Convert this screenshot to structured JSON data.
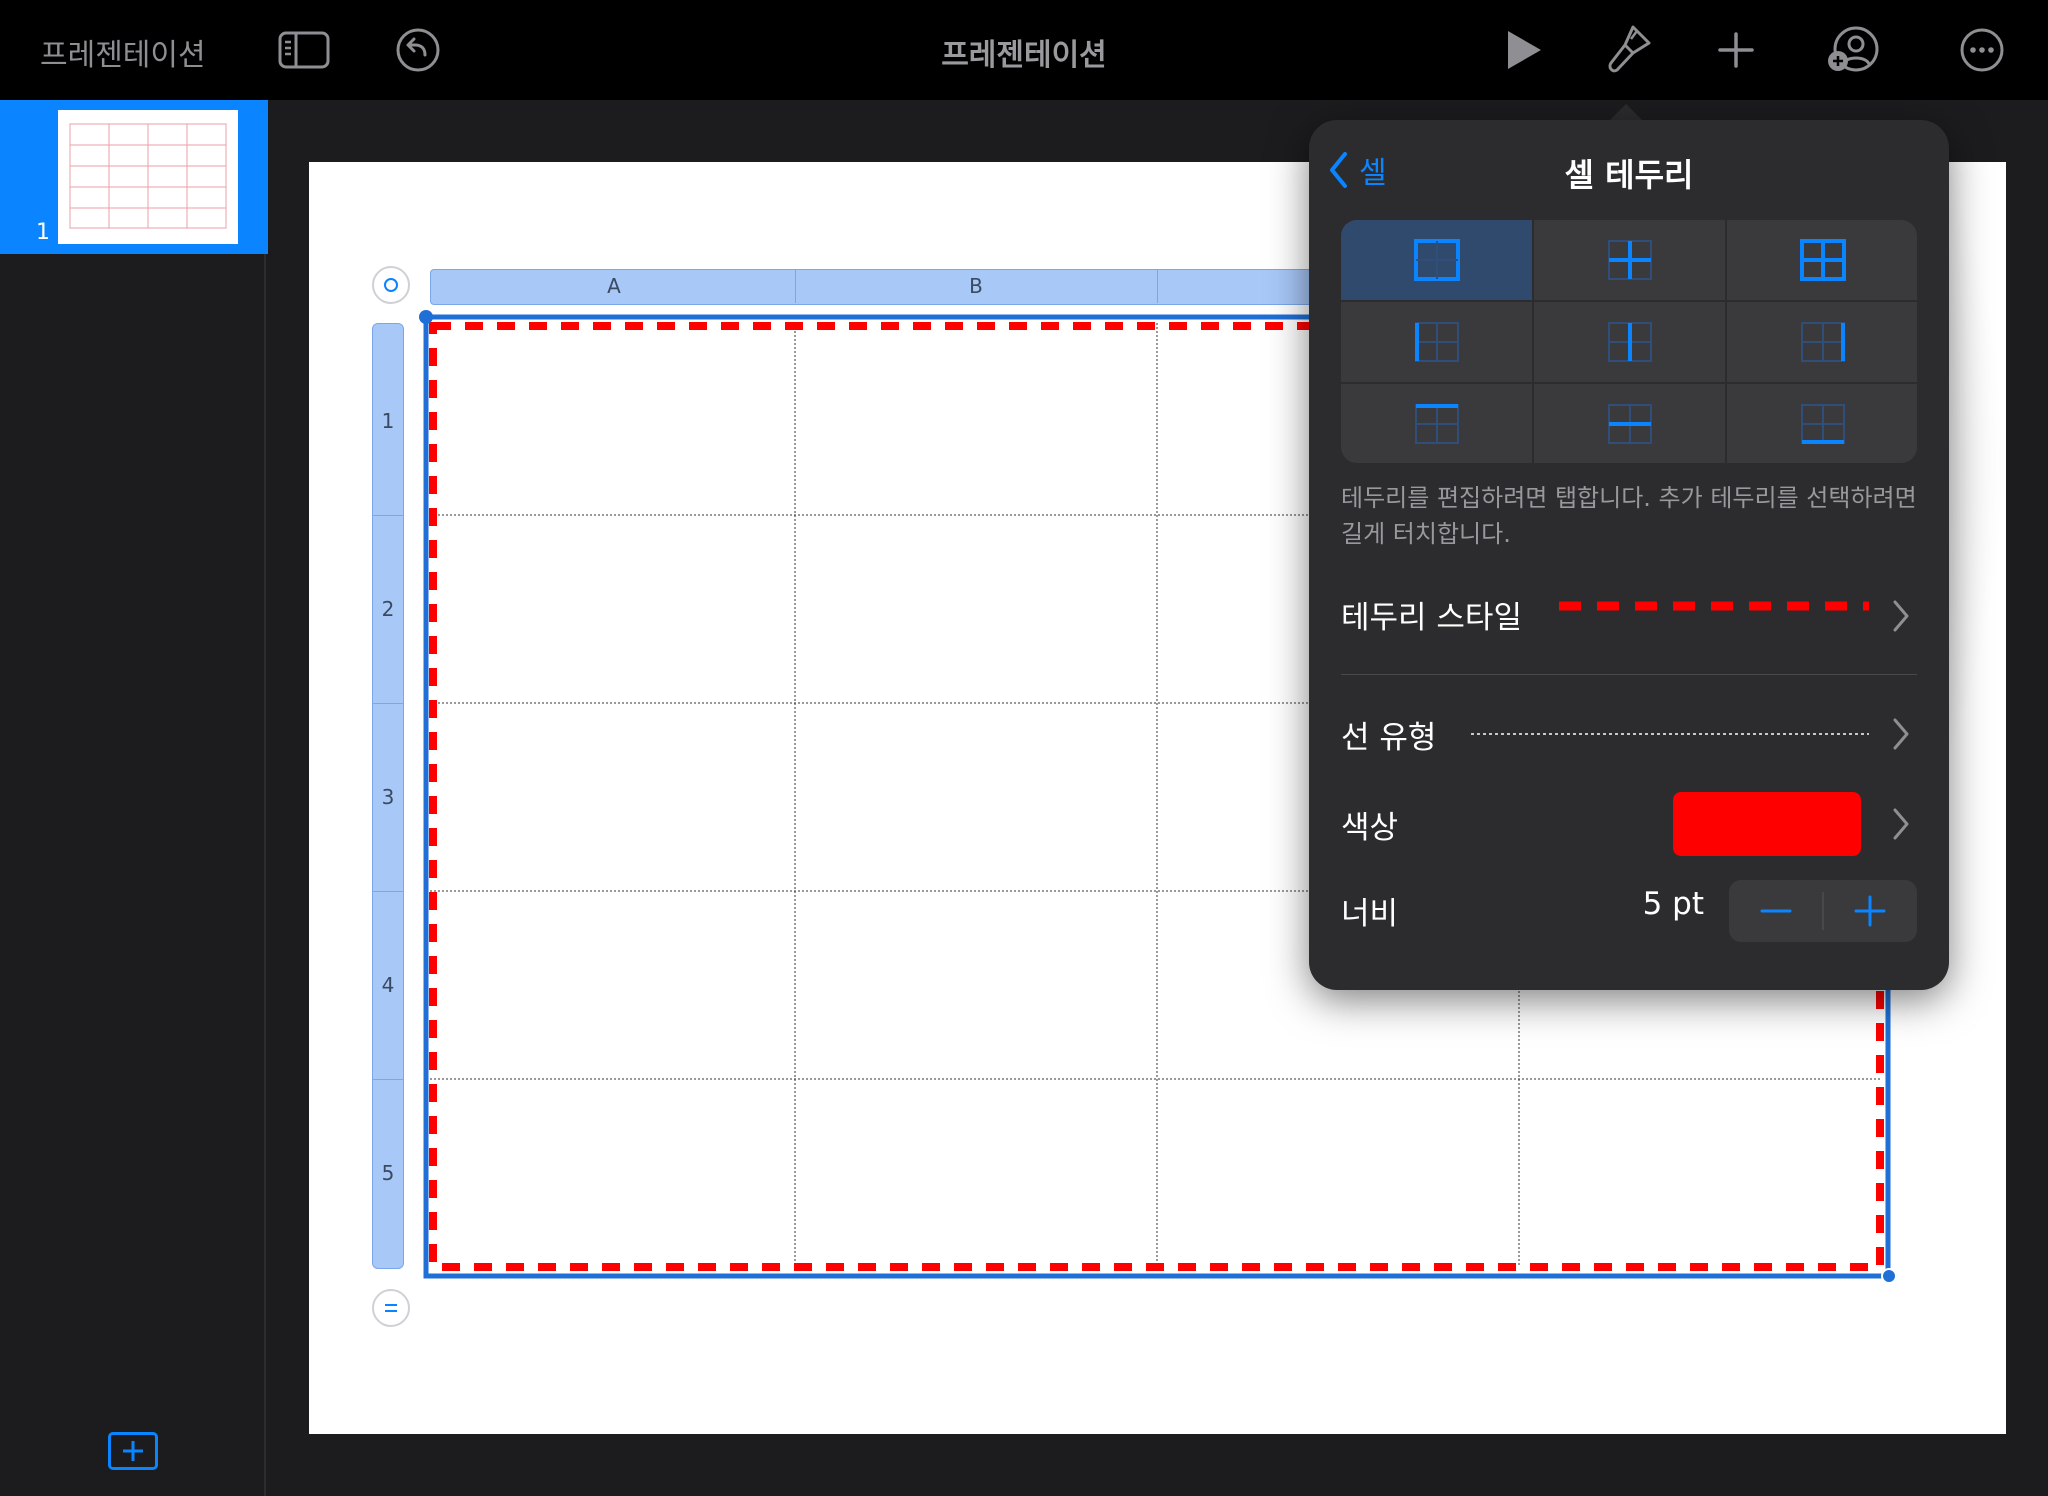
{
  "topbar": {
    "back_label": "프레젠테이션",
    "doc_title": "프레젠테이션",
    "icons": [
      "sidebar-toggle-icon",
      "undo-icon",
      "play-icon",
      "format-brush-icon",
      "add-icon",
      "collaborate-icon",
      "more-icon"
    ]
  },
  "sidebar": {
    "slides": [
      {
        "number": "1"
      }
    ],
    "add_slide_icon": "plus-icon"
  },
  "table": {
    "columns": [
      "A",
      "B"
    ],
    "rows": [
      "1",
      "2",
      "3",
      "4",
      "5"
    ],
    "border_color": "#ff0000",
    "selection_color": "#1f6fd6",
    "add_column_icon": "circle-icon",
    "add_row_icon": "equals-icon"
  },
  "popover": {
    "back_label": "셀",
    "title": "셀 테두리",
    "border_options": [
      "outer-border",
      "inner-border",
      "all-borders",
      "left-border",
      "vertical-inner-border",
      "right-border",
      "top-border",
      "horizontal-inner-border",
      "bottom-border"
    ],
    "selected_option": "outer-border",
    "hint": "테두리를 편집하려면 탭합니다. 추가 테두리를 선택하려면 길게 터치합니다.",
    "border_style_label": "테두리 스타일",
    "line_type_label": "선 유형",
    "color_label": "색상",
    "color_value": "#ff0000",
    "width_label": "너비",
    "width_value": "5 pt",
    "accent_color": "#0a84ff"
  }
}
